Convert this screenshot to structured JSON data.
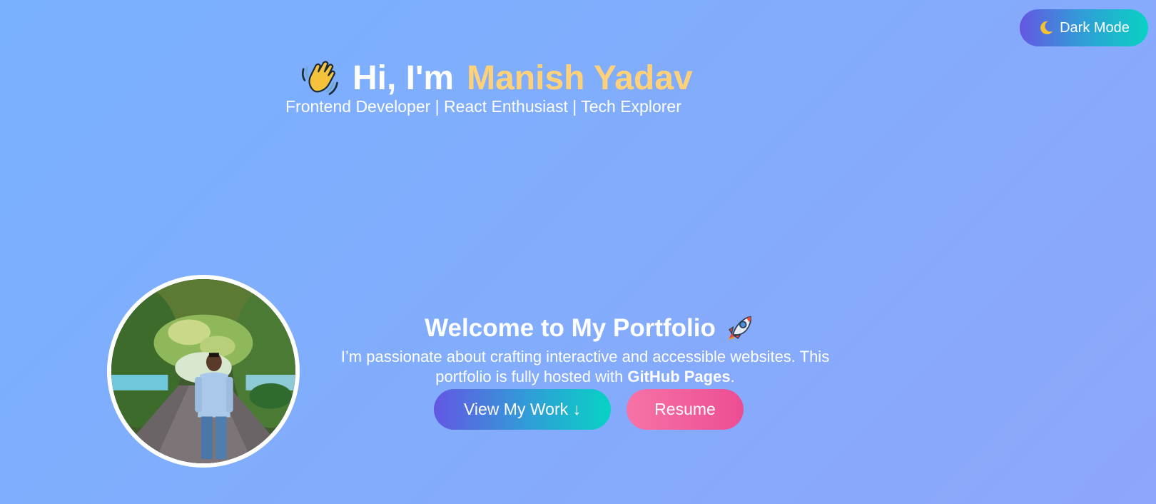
{
  "toggle": {
    "icon": "crescent-moon-icon",
    "label": "Dark Mode"
  },
  "hero": {
    "icon": "waving-hand-icon",
    "greeting": "Hi, I'm",
    "name": "Manish Yadav",
    "name_color": "#ffd27a",
    "subtitle": "Frontend Developer | React Enthusiast | Tech Explorer"
  },
  "avatar": {
    "alt": "profile-photo"
  },
  "welcome": {
    "title": "Welcome to My Portfolio",
    "title_icon": "rocket-icon",
    "text_before": "I’m passionate about crafting interactive and accessible websites. This portfolio is fully hosted with",
    "text_bold": "GitHub Pages",
    "text_after": "."
  },
  "buttons": {
    "view_work": "View My Work ↓",
    "resume": "Resume"
  },
  "colors": {
    "background_start": "#79b1ff",
    "background_end": "#8ea6fb",
    "gradient_purple": "#6457e3",
    "gradient_teal": "#08d2c4",
    "pink_start": "#f773a6",
    "pink_end": "#ec4d93"
  }
}
